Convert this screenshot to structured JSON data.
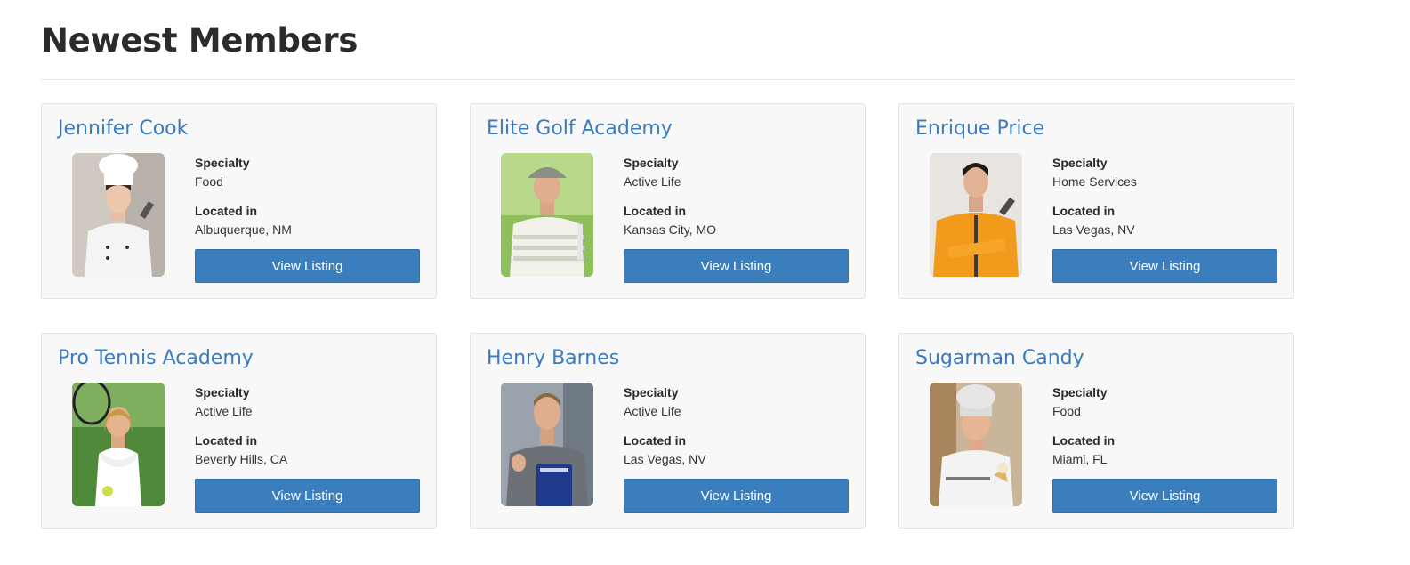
{
  "page": {
    "title": "Newest Members"
  },
  "colors": {
    "accent": "#3b7ebd",
    "name_link": "#3a7bbf",
    "card_bg": "#f8f8f8"
  },
  "members": [
    {
      "name": "Jennifer Cook",
      "specialty_label": "Specialty",
      "specialty": "Food",
      "located_label": "Located in",
      "location": "Albuquerque, NM",
      "button": "View Listing",
      "photo": "chef-woman-photo"
    },
    {
      "name": "Elite Golf Academy",
      "specialty_label": "Specialty",
      "specialty": "Active Life",
      "located_label": "Located in",
      "location": "Kansas City, MO",
      "button": "View Listing",
      "photo": "golfer-man-photo"
    },
    {
      "name": "Enrique Price",
      "specialty_label": "Specialty",
      "specialty": "Home Services",
      "located_label": "Located in",
      "location": "Las Vegas, NV",
      "button": "View Listing",
      "photo": "mechanic-man-photo"
    },
    {
      "name": "Pro Tennis Academy",
      "specialty_label": "Specialty",
      "specialty": "Active Life",
      "located_label": "Located in",
      "location": "Beverly Hills, CA",
      "button": "View Listing",
      "photo": "tennis-woman-photo"
    },
    {
      "name": "Henry Barnes",
      "specialty_label": "Specialty",
      "specialty": "Active Life",
      "located_label": "Located in",
      "location": "Las Vegas, NV",
      "button": "View Listing",
      "photo": "trainer-man-photo"
    },
    {
      "name": "Sugarman Candy",
      "specialty_label": "Specialty",
      "specialty": "Food",
      "located_label": "Located in",
      "location": "Miami, FL",
      "button": "View Listing",
      "photo": "confectioner-man-photo"
    }
  ]
}
